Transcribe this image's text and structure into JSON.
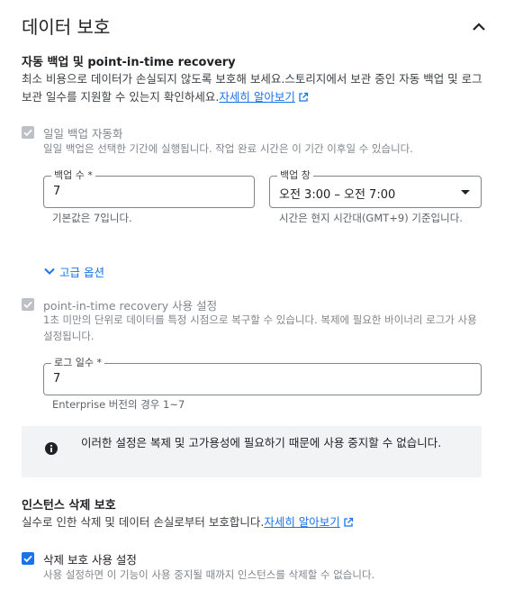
{
  "header": {
    "title": "데이터 보호",
    "collapse_icon": "chevron-up-icon"
  },
  "backup": {
    "title": "자동 백업 및 point-in-time recovery",
    "description": "최소 비용으로 데이터가 손실되지 않도록 보호해 보세요.스토리지에서 보관 중인 자동 백업 및 로그 보관 일수를 지원할 수 있는지 확인하세요.",
    "link": "자세히 알아보기"
  },
  "daily_backup": {
    "label": "일일 백업 자동화",
    "description": "일일 백업은 선택한 기간에 실행됩니다. 작업 완료 시간은 이 기간 이후일 수 있습니다.",
    "checked": true,
    "disabled": true
  },
  "backup_count": {
    "label": "백업 수 *",
    "value": "7",
    "hint": "기본값은 7입니다."
  },
  "backup_window": {
    "label": "백업 창",
    "value": "오전 3:00 – 오전 7:00",
    "hint": "시간은 현지 시간대(GMT+9) 기준입니다."
  },
  "advanced": {
    "label": "고급 옵션",
    "icon": "chevron-down-icon"
  },
  "pitr": {
    "label": "point-in-time recovery 사용 설정",
    "description": "1초 미만의 단위로 데이터를 특정 시점으로 복구할 수 있습니다. 복제에 필요한 바이너리 로그가 사용 설정됩니다.",
    "checked": true,
    "disabled": true
  },
  "log_days": {
    "label": "로그 일수 *",
    "value": "7",
    "hint": "Enterprise 버전의 경우 1~7"
  },
  "info": {
    "icon": "info-icon",
    "text": "이러한 설정은 복제 및 고가용성에 필요하기 때문에 사용 중지할 수 없습니다."
  },
  "deletion": {
    "title": "인스턴스 삭제 보호",
    "description": "실수로 인한 삭제 및 데이터 손실로부터 보호합니다.",
    "link": "자세히 알아보기"
  },
  "deletion_protection": {
    "label": "삭제 보호 사용 설정",
    "description": "사용 설정하면 이 기능이 사용 중지될 때까지 인스턴스를 삭제할 수 없습니다.",
    "checked": true
  },
  "colors": {
    "accent": "#1a73e8",
    "disabled": "#bdc1c6",
    "text": "#202124",
    "muted": "#80868b"
  }
}
